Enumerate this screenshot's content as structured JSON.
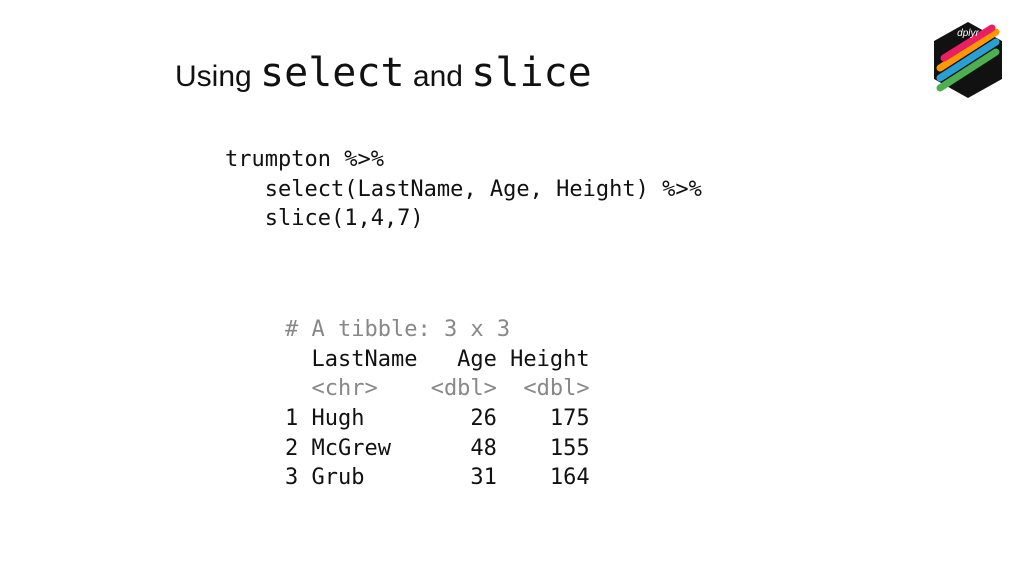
{
  "heading": {
    "p1": "Using",
    "code1": "select",
    "p2": " and ",
    "code2": "slice"
  },
  "code": {
    "line1": "trumpton %>%",
    "line2": "   select(LastName, Age, Height) %>%",
    "line3": "   slice(1,4,7)"
  },
  "output": {
    "tibble_header": "# A tibble: 3 x 3",
    "col_header": "  LastName   Age Height",
    "types": "  <chr>    <dbl>  <dbl>",
    "rows": [
      "1 Hugh        26    175",
      "2 McGrew      48    155",
      "3 Grub        31    164"
    ]
  },
  "chart_data": {
    "type": "table",
    "title": "A tibble: 3 x 3",
    "columns": [
      "LastName",
      "Age",
      "Height"
    ],
    "coltypes": [
      "chr",
      "dbl",
      "dbl"
    ],
    "rows": [
      {
        "LastName": "Hugh",
        "Age": 26,
        "Height": 175
      },
      {
        "LastName": "McGrew",
        "Age": 48,
        "Height": 155
      },
      {
        "LastName": "Grub",
        "Age": 31,
        "Height": 164
      }
    ]
  },
  "logo": {
    "label": "dplyr"
  }
}
